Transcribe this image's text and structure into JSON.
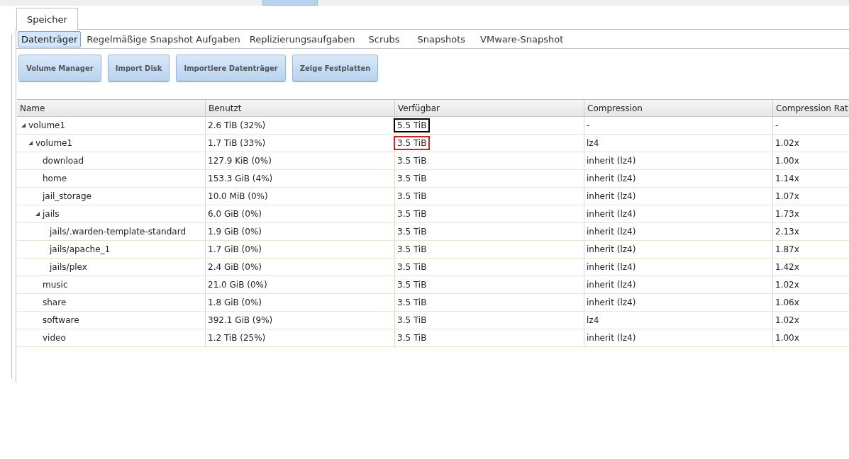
{
  "main_tab": {
    "label": "Speicher",
    "selected": true
  },
  "sub_tabs": [
    {
      "label": "Datenträger",
      "selected": true
    },
    {
      "label": "Regelmäßige Snapshot Aufgaben",
      "selected": false
    },
    {
      "label": "Replizierungsaufgaben",
      "selected": false
    },
    {
      "label": "Scrubs",
      "selected": false
    },
    {
      "label": "Snapshots",
      "selected": false
    },
    {
      "label": "VMware-Snapshot",
      "selected": false
    }
  ],
  "buttons": [
    "Volume Manager",
    "Import Disk",
    "Importiere Datenträger",
    "Zeige Festplatten"
  ],
  "table": {
    "columns": [
      "Name",
      "Benutzt",
      "Verfügbar",
      "Compression",
      "Compression Rat"
    ],
    "rows": [
      {
        "name": "volume1",
        "used": "2.6 TiB (32%)",
        "available": "5.5 TiB",
        "color": "#000000",
        "compression": "-",
        "ratio": "-",
        "expanded": true,
        "children": [
          {
            "name": "volume1",
            "used": "1.7 TiB (33%)",
            "available": "3.5 TiB",
            "color": "#cc2222",
            "compression": "lz4",
            "ratio": "1.02x",
            "expanded": true,
            "children": [
              {
                "name": "download",
                "used": "127.9 KiB (0%)",
                "available": "3.5 TiB",
                "compression": "inherit (lz4)",
                "ratio": "1.00x"
              },
              {
                "name": "home",
                "used": "153.3 GiB (4%)",
                "available": "3.5 TiB",
                "compression": "inherit (lz4)",
                "ratio": "1.14x"
              },
              {
                "name": "jail_storage",
                "used": "10.0 MiB (0%)",
                "available": "3.5 TiB",
                "compression": "inherit (lz4)",
                "ratio": "1.07x"
              },
              {
                "name": "jails",
                "used": "6.0 GiB (0%)",
                "available": "3.5 TiB",
                "compression": "inherit (lz4)",
                "ratio": "1.73x",
                "expanded": true,
                "children": [
                  {
                    "name": "jails/.warden-template-standard",
                    "used": "1.9 GiB (0%)",
                    "available": "3.5 TiB",
                    "compression": "inherit (lz4)",
                    "ratio": "2.13x"
                  },
                  {
                    "name": "jails/apache_1",
                    "used": "1.7 GiB (0%)",
                    "available": "3.5 TiB",
                    "compression": "inherit (lz4)",
                    "ratio": "1.87x"
                  },
                  {
                    "name": "jails/plex",
                    "used": "2.4 GiB (0%)",
                    "available": "3.5 TiB",
                    "compression": "inherit (lz4)",
                    "ratio": "1.42x"
                  }
                ]
              },
              {
                "name": "music",
                "used": "21.0 GiB (0%)",
                "available": "3.5 TiB",
                "compression": "inherit (lz4)",
                "ratio": "1.02x"
              },
              {
                "name": "share",
                "used": "1.8 GiB (0%)",
                "available": "3.5 TiB",
                "compression": "inherit (lz4)",
                "ratio": "1.06x"
              },
              {
                "name": "software",
                "used": "392.1 GiB (9%)",
                "available": "3.5 TiB",
                "compression": "lz4",
                "ratio": "1.02x"
              },
              {
                "name": "video",
                "used": "1.2 TiB (25%)",
                "available": "3.5 TiB",
                "compression": "inherit (lz4)",
                "ratio": "1.00x"
              }
            ]
          }
        ]
      }
    ]
  }
}
